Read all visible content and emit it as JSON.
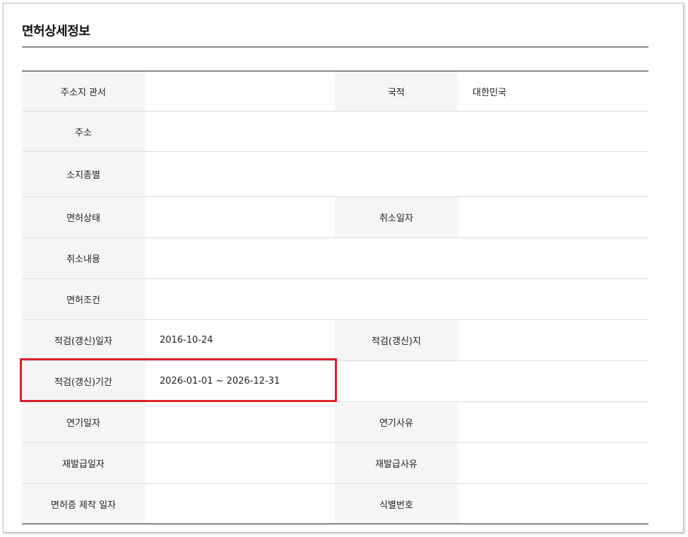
{
  "section": {
    "title": "면허상세정보"
  },
  "rows": [
    {
      "l1": "주소지 관서",
      "v1": "",
      "l2": "국적",
      "v2": "대한민국"
    },
    {
      "l1": "주소",
      "v1": ""
    },
    {
      "l1": "소지종별",
      "v1": ""
    },
    {
      "l1": "면허상태",
      "v1": "",
      "l2": "취소일자",
      "v2": ""
    },
    {
      "l1": "취소내용",
      "v1": ""
    },
    {
      "l1": "면허조건",
      "v1": ""
    },
    {
      "l1": "적검(갱신)일자",
      "v1": "2016-10-24",
      "l2": "적검(갱신)지",
      "v2": ""
    },
    {
      "l1": "적검(갱신)기간",
      "v1": "2026-01-01 ~ 2026-12-31",
      "l2": "",
      "v2": ""
    },
    {
      "l1": "연기일자",
      "v1": "",
      "l2": "연기사유",
      "v2": ""
    },
    {
      "l1": "재발급일자",
      "v1": "",
      "l2": "재발급사유",
      "v2": ""
    },
    {
      "l1": "면허증 제작 일자",
      "v1": "",
      "l2": "식별번호",
      "v2": ""
    }
  ],
  "colors": {
    "highlight": "#e0202a",
    "header_bg": "#f5f5f5"
  }
}
